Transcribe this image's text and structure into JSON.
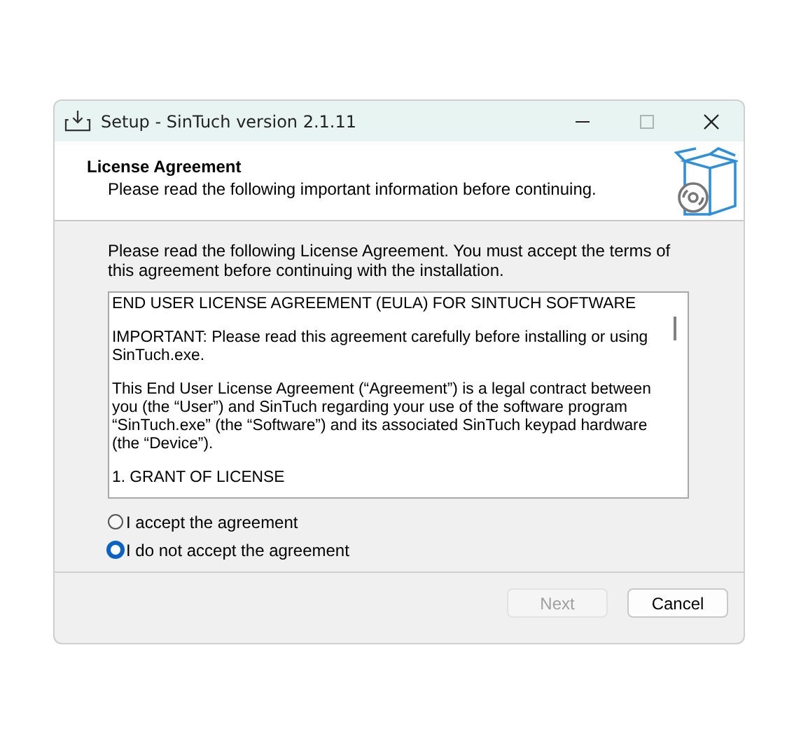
{
  "window": {
    "title": "Setup - SinTuch version 2.1.11",
    "controls": [
      {
        "kind": "minimize",
        "disabled": false
      },
      {
        "kind": "maximize",
        "disabled": true
      },
      {
        "kind": "close",
        "disabled": false
      }
    ]
  },
  "header": {
    "title": "License Agreement",
    "subtitle": "Please read the following important information before continuing."
  },
  "intro": "Please read the following License Agreement. You must accept the terms of this agreement before continuing with the installation.",
  "license_text": [
    "END USER LICENSE AGREEMENT (EULA) FOR SINTUCH SOFTWARE",
    "IMPORTANT: Please read this agreement carefully before installing or using SinTuch.exe.",
    "This End User License Agreement (“Agreement”) is a legal contract between you (the “User”) and SinTuch regarding your use of the software program “SinTuch.exe” (the “Software”) and its associated SinTuch keypad hardware (the “Device”).",
    "1. GRANT OF LICENSE"
  ],
  "options": [
    {
      "label": "I accept the agreement",
      "selected": false
    },
    {
      "label": "I do not accept the agreement",
      "selected": true
    }
  ],
  "buttons": [
    {
      "label": "Next",
      "disabled": true
    },
    {
      "label": "Cancel",
      "disabled": false
    }
  ]
}
